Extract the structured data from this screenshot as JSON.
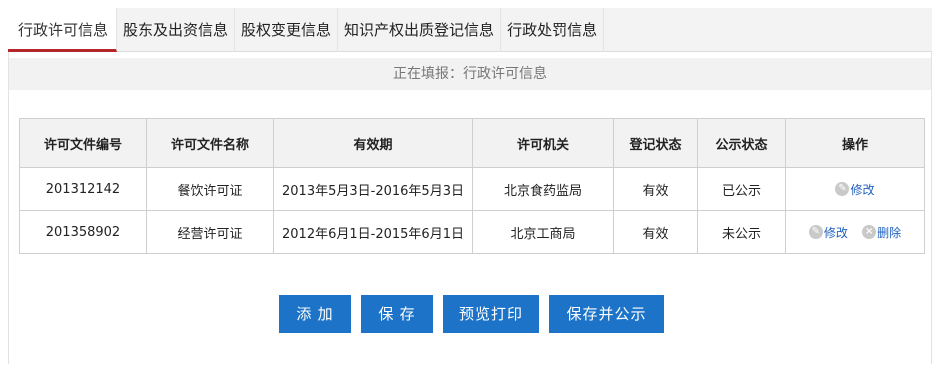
{
  "tabs": [
    {
      "label": "行政许可信息",
      "active": true
    },
    {
      "label": "股东及出资信息",
      "active": false
    },
    {
      "label": "股权变更信息",
      "active": false
    },
    {
      "label": "知识产权出质登记信息",
      "active": false
    },
    {
      "label": "行政处罚信息",
      "active": false
    }
  ],
  "status_text": "正在填报：行政许可信息",
  "table": {
    "headers": [
      "许可文件编号",
      "许可文件名称",
      "有效期",
      "许可机关",
      "登记状态",
      "公示状态",
      "操作"
    ],
    "rows": [
      {
        "number": "201312142",
        "name": "餐饮许可证",
        "validity": "2013年5月3日-2016年5月3日",
        "authority": "北京食药监局",
        "reg_status": "有效",
        "pub_status": "已公示",
        "ops": [
          "修改"
        ]
      },
      {
        "number": "201358902",
        "name": "经营许可证",
        "validity": "2012年6月1日-2015年6月1日",
        "authority": "北京工商局",
        "reg_status": "有效",
        "pub_status": "未公示",
        "ops": [
          "修改",
          "删除"
        ]
      }
    ]
  },
  "buttons": {
    "add": "添 加",
    "save": "保 存",
    "preview_print": "预览打印",
    "save_publish": "保存并公示"
  },
  "colors": {
    "accent": "#1c73c7",
    "active_tab_underline": "#b5262a",
    "link": "#1f5fbf"
  }
}
